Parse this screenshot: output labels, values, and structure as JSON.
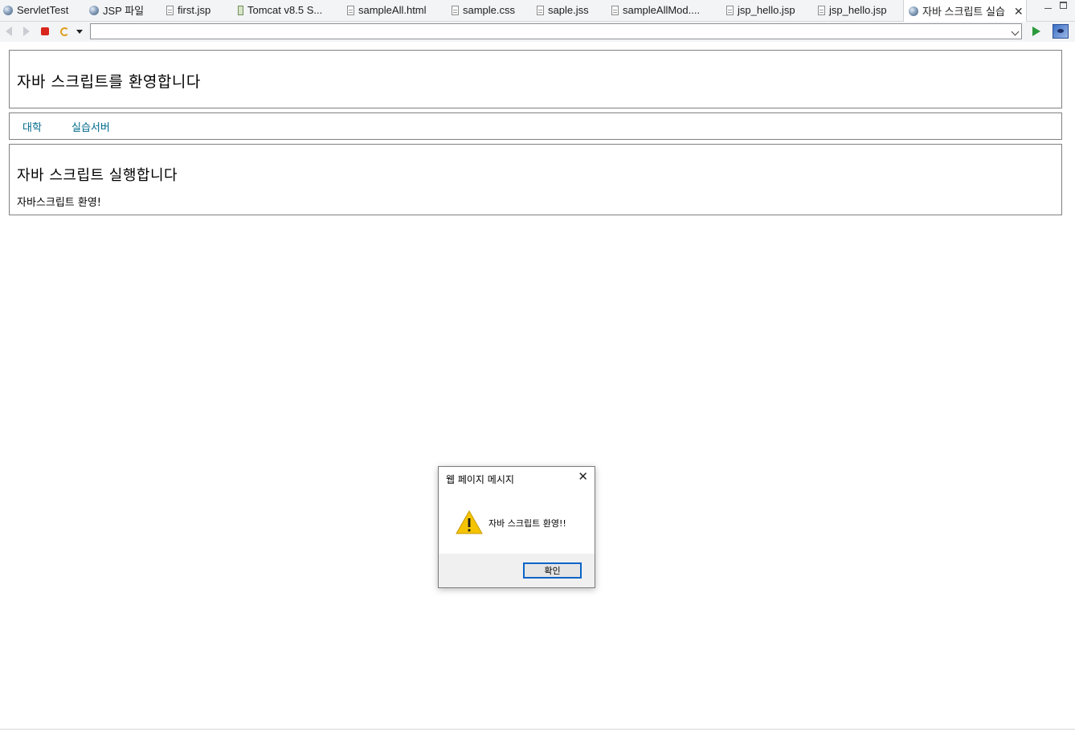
{
  "tabs": [
    {
      "label": "ServletTest",
      "icon": "globe-icon"
    },
    {
      "label": "JSP 파일",
      "icon": "globe-icon"
    },
    {
      "label": "first.jsp",
      "icon": "file-icon"
    },
    {
      "label": "Tomcat v8.5 S...",
      "icon": "jar-icon"
    },
    {
      "label": "sampleAll.html",
      "icon": "file-icon"
    },
    {
      "label": "sample.css",
      "icon": "file-icon"
    },
    {
      "label": "saple.jss",
      "icon": "file-icon"
    },
    {
      "label": "sampleAllMod....",
      "icon": "file-icon"
    },
    {
      "label": "jsp_hello.jsp",
      "icon": "file-icon"
    },
    {
      "label": "jsp_hello.jsp",
      "icon": "file-icon"
    },
    {
      "label": "자바 스크립트 실습",
      "icon": "globe-icon",
      "active": true
    }
  ],
  "toolbar": {
    "url": ""
  },
  "page": {
    "header_title": "자바 스크립트를 환영합니다",
    "nav": [
      "대학",
      "실습서버"
    ],
    "content_title": "자바 스크립트 실행합니다",
    "content_text": "자바스크립트 환영!"
  },
  "dialog": {
    "title": "웹 페이지 메시지",
    "message": "자바 스크립트 환영!!",
    "ok_label": "확인"
  },
  "colors": {
    "link": "#006a8a",
    "warning": "#f5c400",
    "focus": "#0a64c8"
  }
}
